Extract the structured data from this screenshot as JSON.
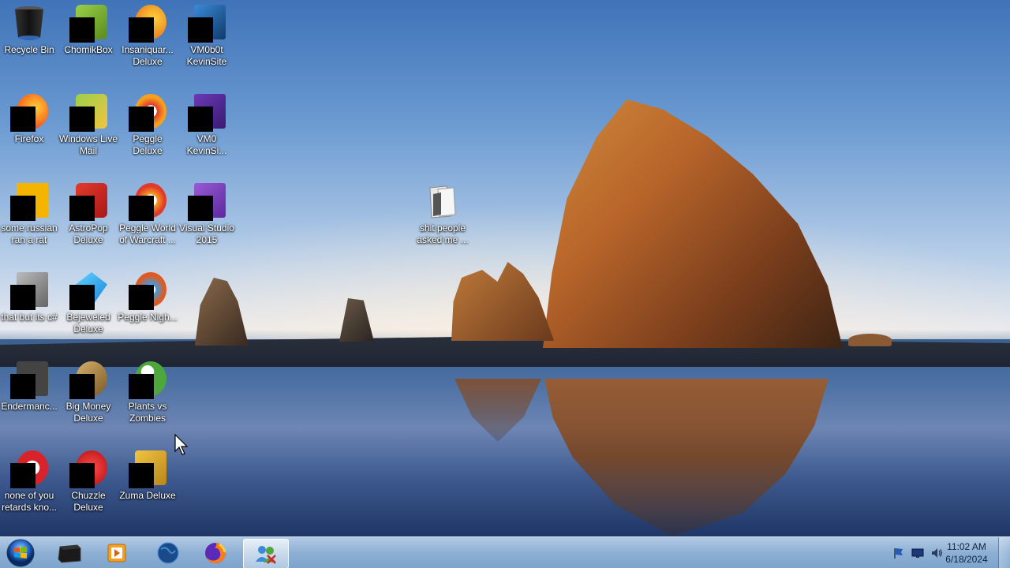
{
  "desktop": {
    "icons": [
      {
        "label": "Recycle Bin"
      },
      {
        "label": "ChomikBox"
      },
      {
        "label": "Insaniquar... Deluxe"
      },
      {
        "label": "VM0b0t KevinSite"
      },
      {
        "label": "Firefox"
      },
      {
        "label": "Windows Live Mail"
      },
      {
        "label": "Peggle Deluxe"
      },
      {
        "label": "VM0 KevinSi..."
      },
      {
        "label": "some russian ran a rat"
      },
      {
        "label": "AstroPop Deluxe"
      },
      {
        "label": "Peggle World of Warcraft ..."
      },
      {
        "label": "Visual Studio 2015"
      },
      {
        "label": "that but its c#"
      },
      {
        "label": "Bejeweled Deluxe"
      },
      {
        "label": "Peggle Nigh..."
      },
      {
        "label": "Endermanc..."
      },
      {
        "label": "Big Money Deluxe"
      },
      {
        "label": "Plants vs Zombies"
      },
      {
        "label": "none of you retards kno..."
      },
      {
        "label": "Chuzzle Deluxe"
      },
      {
        "label": "Zuma Deluxe"
      },
      {
        "label": "shit people asked me ..."
      }
    ]
  },
  "taskbar": {
    "buttons": [
      {
        "icon": "windows-orb-icon"
      },
      {
        "icon": "terminal-icon"
      },
      {
        "icon": "media-player-icon"
      },
      {
        "icon": "globe-icon"
      },
      {
        "icon": "firefox-icon"
      },
      {
        "icon": "users-icon"
      }
    ],
    "tray": [
      "flag-icon",
      "monitor-icon",
      "volume-icon"
    ],
    "clock": {
      "time": "11:02 AM",
      "date": "6/18/2024"
    }
  },
  "colors": {
    "taskbar": "#9fc0e2",
    "label_text": "#ffffff"
  }
}
